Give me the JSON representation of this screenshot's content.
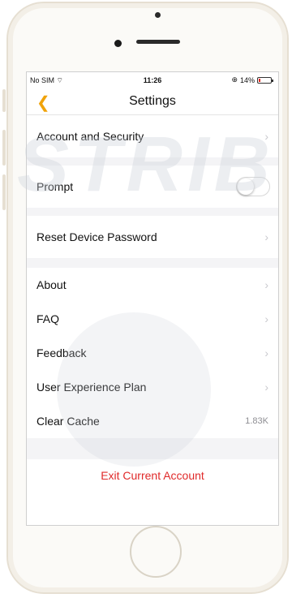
{
  "status_bar": {
    "carrier": "No SIM",
    "time": "11:26",
    "battery": "14%",
    "battery_level": 0.14
  },
  "nav": {
    "back_icon": "chevron-left-icon",
    "title": "Settings"
  },
  "rows": {
    "account_security": "Account and Security",
    "prompt": "Prompt",
    "prompt_enabled": false,
    "reset_password": "Reset Device Password",
    "about": "About",
    "faq": "FAQ",
    "feedback": "Feedback",
    "user_experience": "User Experience Plan",
    "clear_cache": "Clear Cache",
    "cache_size": "1.83K"
  },
  "exit": {
    "label": "Exit Current Account"
  },
  "colors": {
    "accent": "#f0a30a",
    "danger": "#e02a2a",
    "battery_low": "#e2231a"
  }
}
